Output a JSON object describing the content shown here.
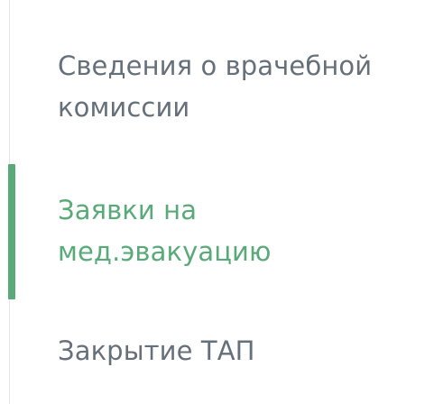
{
  "sidebar": {
    "active_color": "#5aaa79",
    "inactive_color": "#66707a",
    "items": [
      {
        "label_line1": "Сведения о врачебной",
        "label_line2": "комиссии",
        "active": false
      },
      {
        "label_line1": "Заявки на",
        "label_line2": "мед.эвакуацию",
        "active": true
      },
      {
        "label_line1": "Закрытие ТАП",
        "label_line2": "",
        "active": false
      }
    ]
  }
}
